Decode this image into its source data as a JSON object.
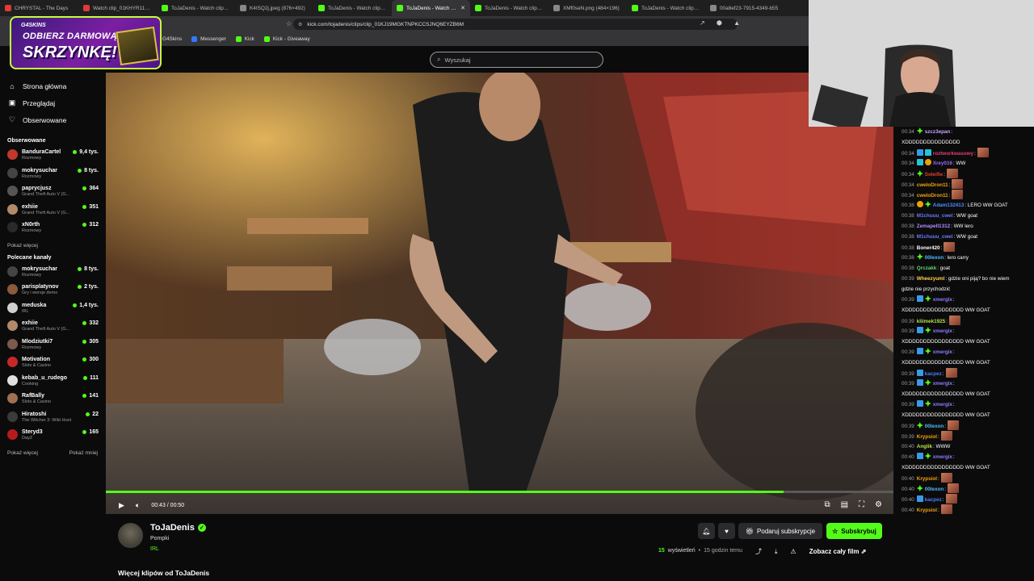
{
  "browser": {
    "tabs": [
      {
        "label": "CHRYSTAL - The Days",
        "color": "#e53935",
        "active": false
      },
      {
        "label": "Watch clip_01KHYR11VE5",
        "color": "#e53935",
        "active": false
      },
      {
        "label": "ToJaDenis - Watch clips or",
        "color": "#53fc18",
        "active": false
      },
      {
        "label": "K4ISQ2j.jpeg (876×492)",
        "color": "#888888",
        "active": false
      },
      {
        "label": "ToJaDenis - Watch clips or",
        "color": "#53fc18",
        "active": false
      },
      {
        "label": "ToJaDenis - Watch clip",
        "color": "#53fc18",
        "active": true
      },
      {
        "label": "ToJaDenis - Watch clips or",
        "color": "#53fc18",
        "active": false
      },
      {
        "label": "XMf0seN.png (484×196)",
        "color": "#888888",
        "active": false
      },
      {
        "label": "ToJaDenis - Watch clips or",
        "color": "#53fc18",
        "active": false
      },
      {
        "label": "00a8ef23-7915-4349-b55",
        "color": "#888888",
        "active": false
      }
    ],
    "url": "kick.com/tojadenis/clips/clip_01KJ19MGKTNPKCCSJNQ6EYZB6M",
    "bookmarks": [
      {
        "label": "G4Skins",
        "color": "#7b1fa2"
      },
      {
        "label": "Messenger",
        "color": "#2f7bff"
      },
      {
        "label": "Kick",
        "color": "#53fc18"
      },
      {
        "label": "Kick - Giveaway",
        "color": "#53fc18"
      }
    ]
  },
  "promo": {
    "brand": "G4SKINS",
    "line1": "ODBIERZ DARMOWĄ",
    "line2": "SKRZYNKĘ!"
  },
  "search": {
    "placeholder": "Wyszukaj"
  },
  "nav": {
    "home": "Strona główna",
    "browse": "Przeglądaj",
    "following": "Obserwowane"
  },
  "following_section": {
    "title": "Obserwowane",
    "channels": [
      {
        "name": "BanduraCartel",
        "game": "Rozmowy",
        "viewers": "9,4 tys.",
        "color": "#c0392b"
      },
      {
        "name": "mokrysuchar",
        "game": "Rozmowy",
        "viewers": "8 tys.",
        "color": "#444444"
      },
      {
        "name": "paprycjusz",
        "game": "Grand Theft Auto V (G...",
        "viewers": "364",
        "color": "#555555"
      },
      {
        "name": "exhiie",
        "game": "Grand Theft Auto V (G...",
        "viewers": "351",
        "color": "#b08a6a"
      },
      {
        "name": "xN0rth",
        "game": "Rozmowy",
        "viewers": "312",
        "color": "#2a2a2a"
      }
    ],
    "more": "Pokaż więcej"
  },
  "recommended_section": {
    "title": "Polecane kanały",
    "channels": [
      {
        "name": "mokrysuchar",
        "game": "Rozmowy",
        "viewers": "8 tys.",
        "color": "#444444"
      },
      {
        "name": "parisplatynov",
        "game": "Gry i wersje demo",
        "viewers": "2 tys.",
        "color": "#8a5a3a"
      },
      {
        "name": "meduska",
        "game": "IRL",
        "viewers": "1,4 tys.",
        "color": "#d0d0d0"
      },
      {
        "name": "exhiie",
        "game": "Grand Theft Auto V (G...",
        "viewers": "332",
        "color": "#b08a6a"
      },
      {
        "name": "Mlodziutki7",
        "game": "Rozmowy",
        "viewers": "305",
        "color": "#7a5a4a"
      },
      {
        "name": "Motivation",
        "game": "Slots & Casino",
        "viewers": "300",
        "color": "#c62828"
      },
      {
        "name": "kebab_u_rudego",
        "game": "Cooking",
        "viewers": "111",
        "color": "#e0e0e0"
      },
      {
        "name": "RafBally",
        "game": "Slots & Casino",
        "viewers": "141",
        "color": "#a07050"
      },
      {
        "name": "Hiratoshi",
        "game": "The Witcher 3: Wild Hunt",
        "viewers": "22",
        "color": "#3a3a3a"
      },
      {
        "name": "Steryd3",
        "game": "DayZ",
        "viewers": "165",
        "color": "#b71c1c"
      }
    ],
    "more": "Pokaż więcej",
    "less": "Pokaż mniej"
  },
  "player": {
    "time": "00:43 / 00:50",
    "progress": 0.86
  },
  "clip": {
    "channel": "ToJaDenis",
    "title": "Pompki",
    "category": "IRL",
    "gift_label": "Podaruj subskrypcje",
    "subscribe_label": "Subskrybuj",
    "views": "15",
    "views_label": "wyświetleń",
    "ago": "15 godzin temu",
    "full_film": "Zobacz cały film",
    "more_clips": "Więcej klipów od ToJaDenis"
  },
  "chat": [
    {
      "time": "00:34",
      "user": "szcz3epan",
      "color": "#c9a0ff",
      "badges": [
        "green"
      ],
      "text": ":",
      "emote": false
    },
    {
      "time": "",
      "user": "",
      "color": "",
      "badges": [],
      "text": "XDDDDDDDDDDDDDDD",
      "emote": false,
      "cont": true
    },
    {
      "time": "00:34",
      "user": "roztworkwasowy",
      "color": "#e43d78",
      "badges": [
        "blue",
        "teal"
      ],
      "text": ":",
      "emote": true
    },
    {
      "time": "00:34",
      "user": "Xrey016",
      "color": "#9a6cff",
      "badges": [
        "teal",
        "gold"
      ],
      "text": ": WW",
      "emote": false
    },
    {
      "time": "00:34",
      "user": "Soleifie",
      "color": "#e5412a",
      "badges": [
        "green"
      ],
      "text": ":",
      "emote": true
    },
    {
      "time": "00:34",
      "user": "cweloDron11",
      "color": "#f4a20c",
      "badges": [],
      "text": ":",
      "emote": true
    },
    {
      "time": "00:34",
      "user": "cweloDron11",
      "color": "#f4a20c",
      "badges": [],
      "text": ":",
      "emote": true
    },
    {
      "time": "00:38",
      "user": "Adam132413",
      "color": "#4a90ff",
      "badges": [
        "gold",
        "green"
      ],
      "text": ": LERO WW GOAT",
      "emote": false
    },
    {
      "time": "00:38",
      "user": "M1chuuu_cwel",
      "color": "#6a7cff",
      "badges": [],
      "text": ": WW goat",
      "emote": false
    },
    {
      "time": "00:38",
      "user": "Zemapell1312",
      "color": "#b08cff",
      "badges": [],
      "text": ": WW lero",
      "emote": false
    },
    {
      "time": "00:38",
      "user": "M1chuuu_cwel",
      "color": "#6a7cff",
      "badges": [],
      "text": ": WW goat",
      "emote": false
    },
    {
      "time": "00:38",
      "user": "Boner420",
      "color": "#ffffff",
      "badges": [],
      "text": ":",
      "emote": true
    },
    {
      "time": "00:38",
      "user": "00lexon",
      "color": "#53b8ff",
      "badges": [
        "green"
      ],
      "text": ": lero carry",
      "emote": false
    },
    {
      "time": "00:38",
      "user": "Qrczakk",
      "color": "#5cd86c",
      "badges": [],
      "text": ": goat",
      "emote": false
    },
    {
      "time": "00:39",
      "user": "Wheezyuml",
      "color": "#ffd24a",
      "badges": [],
      "text": ": gdzie oni piją? bo nie wiem",
      "emote": false
    },
    {
      "time": "",
      "user": "",
      "color": "",
      "badges": [],
      "text": "gdzie nie przychodzić",
      "emote": false,
      "cont": true
    },
    {
      "time": "00:39",
      "user": "xmergix",
      "color": "#8a7cff",
      "badges": [
        "blue",
        "green"
      ],
      "text": ":",
      "emote": false
    },
    {
      "time": "",
      "user": "",
      "color": "",
      "badges": [],
      "text": "XDDDDDDDDDDDDDDDD WW GOAT",
      "emote": false,
      "cont": true
    },
    {
      "time": "00:39",
      "user": "kliimek1925",
      "color": "#b6e04a",
      "badges": [],
      "text": ":",
      "emote": true
    },
    {
      "time": "00:39",
      "user": "xmergix",
      "color": "#8a7cff",
      "badges": [
        "blue",
        "green"
      ],
      "text": ":",
      "emote": false
    },
    {
      "time": "",
      "user": "",
      "color": "",
      "badges": [],
      "text": "XDDDDDDDDDDDDDDDD WW GOAT",
      "emote": false,
      "cont": true
    },
    {
      "time": "00:39",
      "user": "xmergix",
      "color": "#8a7cff",
      "badges": [
        "blue",
        "green"
      ],
      "text": ":",
      "emote": false
    },
    {
      "time": "",
      "user": "",
      "color": "",
      "badges": [],
      "text": "XDDDDDDDDDDDDDDDD WW GOAT",
      "emote": false,
      "cont": true
    },
    {
      "time": "00:39",
      "user": "kacpez",
      "color": "#4a7cff",
      "badges": [
        "blue"
      ],
      "text": ":",
      "emote": true
    },
    {
      "time": "00:39",
      "user": "xmergix",
      "color": "#8a7cff",
      "badges": [
        "blue",
        "green"
      ],
      "text": ":",
      "emote": false
    },
    {
      "time": "",
      "user": "",
      "color": "",
      "badges": [],
      "text": "XDDDDDDDDDDDDDDDD WW GOAT",
      "emote": false,
      "cont": true
    },
    {
      "time": "00:39",
      "user": "xmergix",
      "color": "#8a7cff",
      "badges": [
        "blue",
        "green"
      ],
      "text": ":",
      "emote": false
    },
    {
      "time": "",
      "user": "",
      "color": "",
      "badges": [],
      "text": "XDDDDDDDDDDDDDDDD WW GOAT",
      "emote": false,
      "cont": true
    },
    {
      "time": "00:39",
      "user": "00lexon",
      "color": "#53b8ff",
      "badges": [
        "green"
      ],
      "text": ":",
      "emote": true
    },
    {
      "time": "00:39",
      "user": "Krypsiol",
      "color": "#f4a20c",
      "badges": [],
      "text": ":",
      "emote": true
    },
    {
      "time": "00:40",
      "user": "Anglik",
      "color": "#b6e04a",
      "badges": [],
      "text": ": WWW",
      "emote": false
    },
    {
      "time": "00:40",
      "user": "xmergix",
      "color": "#8a7cff",
      "badges": [
        "blue",
        "green"
      ],
      "text": ":",
      "emote": false
    },
    {
      "time": "",
      "user": "",
      "color": "",
      "badges": [],
      "text": "XDDDDDDDDDDDDDDDD WW GOAT",
      "emote": false,
      "cont": true
    },
    {
      "time": "00:40",
      "user": "Krypsiol",
      "color": "#f4a20c",
      "badges": [],
      "text": ":",
      "emote": true
    },
    {
      "time": "00:40",
      "user": "00lexon",
      "color": "#53b8ff",
      "badges": [
        "green"
      ],
      "text": ":",
      "emote": true
    },
    {
      "time": "00:40",
      "user": "kacpez",
      "color": "#4a7cff",
      "badges": [
        "blue"
      ],
      "text": ":",
      "emote": true
    },
    {
      "time": "00:40",
      "user": "Krypsiol",
      "color": "#f4a20c",
      "badges": [],
      "text": ":",
      "emote": true
    }
  ]
}
